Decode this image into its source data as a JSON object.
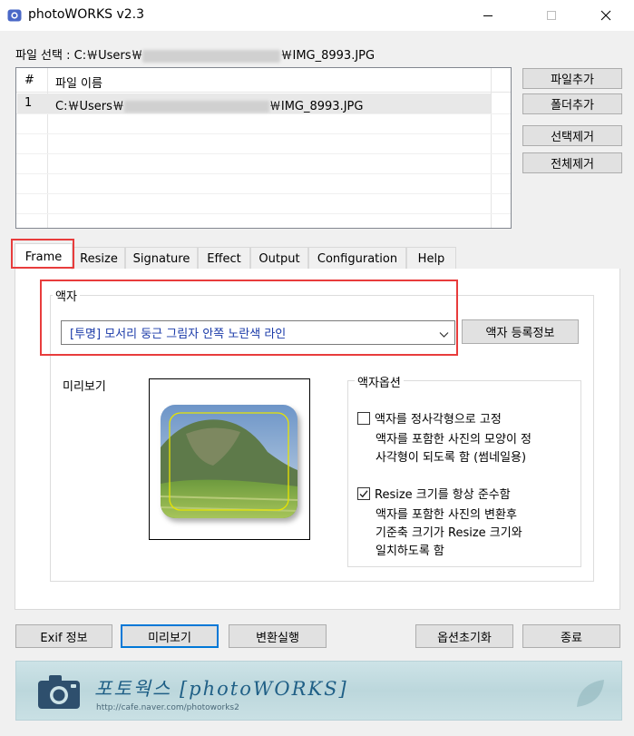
{
  "window": {
    "title": "photoWORKS v2.3"
  },
  "file_selection": {
    "label": "파일 선택 : C:￦Users￦",
    "path_suffix": "￦IMG_8993.JPG"
  },
  "file_list": {
    "columns": [
      "#",
      "파일 이름"
    ],
    "rows": [
      {
        "index": "1",
        "path_prefix": "C:￦Users￦",
        "path_suffix": "￦IMG_8993.JPG"
      }
    ]
  },
  "side_buttons": {
    "add_file": "파일추가",
    "add_folder": "폴더추가",
    "remove_selected": "선택제거",
    "remove_all": "전체제거"
  },
  "tabs": [
    "Frame",
    "Resize",
    "Signature",
    "Effect",
    "Output",
    "Configuration",
    "Help"
  ],
  "frame": {
    "group_label": "액자",
    "selected_frame": "[투명] 모서리 둥근 그림자 안쪽 노란색 라인",
    "register_button": "액자 등록정보",
    "preview_label": "미리보기",
    "options_label": "액자옵션",
    "options": [
      {
        "label": "액자를 정사각형으로 고정",
        "checked": false,
        "description": [
          "액자를 포함한 사진의 모양이 정",
          "사각형이 되도록 함 (썸네일용)"
        ]
      },
      {
        "label": "Resize 크기를 항상 준수함",
        "checked": true,
        "description": [
          "액자를 포함한 사진의 변환후",
          "기준축 크기가 Resize 크기와",
          "일치하도록 함"
        ]
      }
    ]
  },
  "bottom_buttons": {
    "exif": "Exif 정보",
    "preview": "미리보기",
    "convert": "변환실행",
    "reset_options": "옵션초기화",
    "exit": "종료"
  },
  "banner": {
    "title": "포토웍스 [photoWORKS]",
    "url": "http://cafe.naver.com/photoworks2"
  },
  "colors": {
    "highlight_red": "#e83c3c",
    "combo_text": "#1a3aa8"
  }
}
